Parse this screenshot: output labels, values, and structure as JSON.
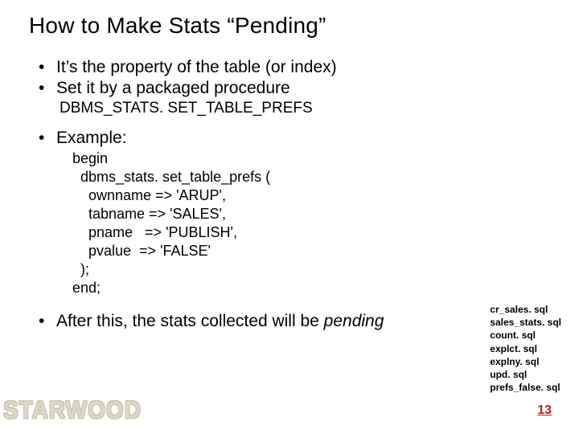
{
  "title": "How to Make Stats “Pending”",
  "bullets": {
    "b1": "It’s the property of the table (or index)",
    "b2": "Set it by a packaged procedure",
    "proc": "DBMS_STATS. SET_TABLE_PREFS",
    "b3": "Example:",
    "code": "begin\n  dbms_stats. set_table_prefs (\n    ownname => 'ARUP',\n    tabname => 'SALES',\n    pname   => 'PUBLISH',\n    pvalue  => 'FALSE'\n  );\nend;",
    "b4_prefix": "After this, the stats collected will be ",
    "b4_emph": "pending"
  },
  "files": {
    "f1": "cr_sales. sql",
    "f2": "sales_stats. sql",
    "f3": "count. sql",
    "f4": "explct. sql",
    "f5": "explny. sql",
    "f6": "upd. sql",
    "f7": "prefs_false. sql"
  },
  "pagenum": "13",
  "brand": "STARWOOD"
}
